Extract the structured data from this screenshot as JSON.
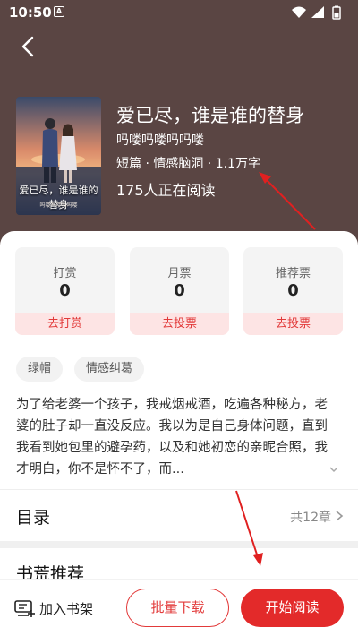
{
  "status_bar": {
    "time": "10:50",
    "notification_letter": "A"
  },
  "book": {
    "title": "爱已尽，谁是谁的替身",
    "author": "吗喽吗喽吗吗喽",
    "meta": "短篇 · 情感脑洞 · 1.1万字",
    "readers": "175人正在阅读",
    "cover_title": "爱已尽，谁是谁的替身",
    "cover_author": "吗喽吗喽吗吗喽"
  },
  "stats": [
    {
      "label": "打赏",
      "value": "0",
      "action": "去打赏"
    },
    {
      "label": "月票",
      "value": "0",
      "action": "去投票"
    },
    {
      "label": "推荐票",
      "value": "0",
      "action": "去投票"
    }
  ],
  "tags": [
    "绿帽",
    "情感纠葛"
  ],
  "description": "为了给老婆一个孩子，我戒烟戒酒，吃遍各种秘方，老婆的肚子却一直没反应。我以为是自己身体问题，直到我看到她包里的避孕药，以及和她初恋的亲昵合照，我才明白，你不是怀不了，而...",
  "toc": {
    "title": "目录",
    "count": "共12章"
  },
  "recommendation": {
    "title": "书荒推荐"
  },
  "bottom_bar": {
    "shelf_label": "加入书架",
    "download_label": "批量下载",
    "read_label": "开始阅读"
  },
  "colors": {
    "header_bg": "#5a4543",
    "accent": "#e32a2a",
    "annotation_arrow": "#e02020"
  }
}
